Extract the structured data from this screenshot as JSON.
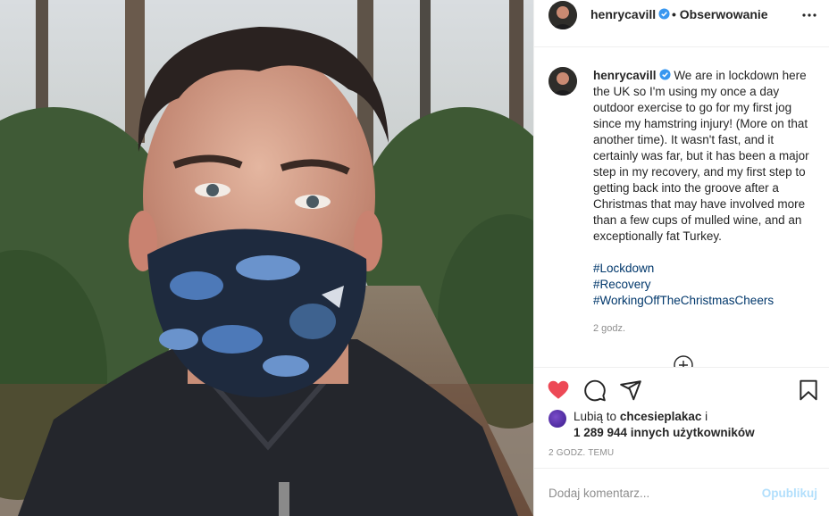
{
  "post": {
    "author": "henrycavill",
    "follow_label": "• Obserwowanie",
    "caption_text": "We are in lockdown here the UK so I'm using my once a day outdoor exercise to go for my first jog since my hamstring injury! (More on that another time). It wasn't fast, and it certainly was far, but it has been a major step in my recovery, and my first step to getting back into the groove after a Christmas that may have involved more than a few cups of mulled wine, and an exceptionally fat Turkey.",
    "hashtags": [
      "#Lockdown",
      "#Recovery",
      "#WorkingOffTheChristmasCheers"
    ],
    "caption_time": "2 godz.",
    "likes_prefix": "Lubią to",
    "liker": "chcesieplakac",
    "likes_connector": "i",
    "likes_count_text": "1 289 944 innych użytkowników",
    "post_time": "2 GODZ. TEMU",
    "comment_placeholder": "Dodaj komentarz...",
    "publish_label": "Opublikuj"
  },
  "icons": {
    "more": "more-horizontal-icon",
    "verified": "verified-badge-icon",
    "like": "heart-icon",
    "comment": "comment-icon",
    "share": "share-icon",
    "save": "bookmark-icon",
    "load_more": "plus-circle-icon"
  },
  "colors": {
    "like_red": "#ed4956",
    "verified_blue": "#3897f0",
    "hashtag_blue": "#00376b",
    "muted_grey": "#8e8e8e",
    "publish_disabled": "#b2dffc"
  }
}
